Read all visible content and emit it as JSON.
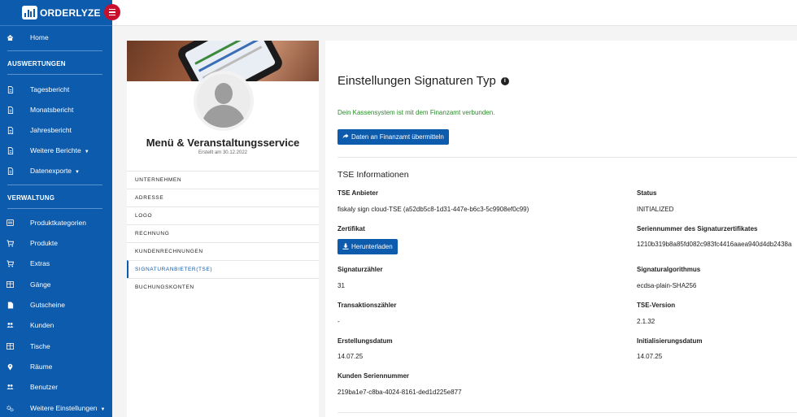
{
  "brand": {
    "name": "ORDERLYZE"
  },
  "sidebar": {
    "home": "Home",
    "section_reports": "AUSWERTUNGEN",
    "reports": [
      "Tagesbericht",
      "Monatsbericht",
      "Jahresbericht",
      "Weitere Berichte",
      "Datenexporte"
    ],
    "section_admin": "VERWALTUNG",
    "admin": [
      "Produktkategorien",
      "Produkte",
      "Extras",
      "Gänge",
      "Gutscheine",
      "Kunden",
      "Tische",
      "Räume",
      "Benutzer",
      "Weitere Einstellungen"
    ]
  },
  "profile": {
    "name": "Menü & Veranstaltungsservice",
    "created": "Erstellt am 30.12.2022",
    "nav": [
      "UNTERNEHMEN",
      "ADRESSE",
      "LOGO",
      "RECHNUNG",
      "KUNDENRECHNUNGEN",
      "SIGNATURANBIETER(TSE)",
      "BUCHUNGSKONTEN"
    ]
  },
  "main": {
    "title": "Einstellungen Signaturen Typ",
    "status_msg": "Dein Kassensystem ist mit dem Finanzamt verbunden.",
    "submit_btn": "Daten an Finanzamt übermitteln",
    "tse_title": "TSE Informationen",
    "fields": {
      "provider_label": "TSE Anbieter",
      "provider_value": "fiskaly sign cloud-TSE (a52db5c8-1d31-447e-b6c3-5c9908ef0c99)",
      "status_label": "Status",
      "status_value": "INITIALIZED",
      "cert_label": "Zertifikat",
      "download_btn": "Herunterladen",
      "serial_label": "Seriennummer des Signaturzertifikates",
      "serial_value": "1210b319b8a85fd082c983fc4416aaea940d4db2438a",
      "sigcount_label": "Signaturzähler",
      "sigcount_value": "31",
      "algo_label": "Signaturalgorithmus",
      "algo_value": "ecdsa-plain-SHA256",
      "txcount_label": "Transaktionszähler",
      "txcount_value": "-",
      "version_label": "TSE-Version",
      "version_value": "2.1.32",
      "created_label": "Erstellungsdatum",
      "created_value": "14.07.25",
      "init_label": "Initialisierungsdatum",
      "init_value": "14.07.25",
      "customer_serial_label": "Kunden Seriennummer",
      "customer_serial_value": "219ba1e7-c8ba-4024-8161-ded1d225e877"
    }
  }
}
